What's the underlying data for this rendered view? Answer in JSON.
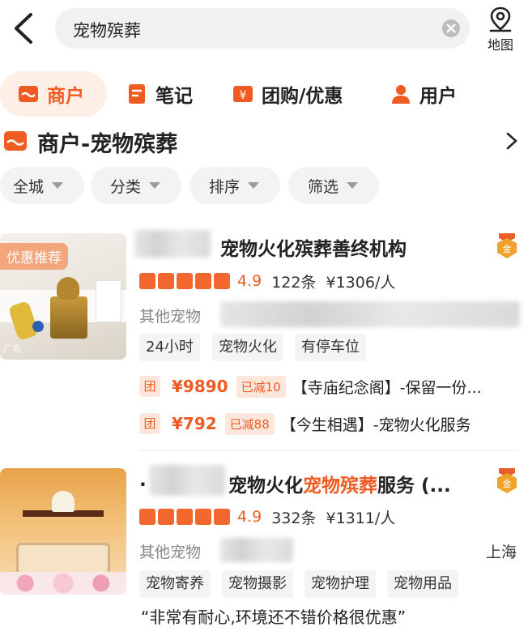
{
  "search": {
    "query": "宠物殡葬"
  },
  "header": {
    "map_label": "地图"
  },
  "tabs": [
    {
      "label": "商户"
    },
    {
      "label": "笔记"
    },
    {
      "label": "团购/优惠"
    },
    {
      "label": "用户"
    }
  ],
  "section": {
    "title": "商户-宠物殡葬"
  },
  "filters": [
    {
      "label": "全城"
    },
    {
      "label": "分类"
    },
    {
      "label": "排序"
    },
    {
      "label": "筛选"
    }
  ],
  "shops": [
    {
      "name": "宠物火化殡葬善终机构",
      "promo_tag": "优惠推荐",
      "ad_tag": "广告",
      "stars": 5,
      "score": "4.9",
      "reviews": "122条",
      "price": "¥1306/人",
      "category": "其他宠物",
      "tags": [
        "24小时",
        "宠物火化",
        "有停车位"
      ],
      "deals": [
        {
          "badge": "团",
          "price": "¥9890",
          "off": "已减10",
          "desc": "【寺庙纪念阁】-保留一份..."
        },
        {
          "badge": "团",
          "price": "¥792",
          "off": "已减88",
          "desc": "【今生相遇】-宠物火化服务"
        }
      ]
    },
    {
      "name_prefix": ".",
      "name_pre": "宠物火化",
      "name_highlight": "宠物殡葬",
      "name_post": "服务 (...",
      "stars": 5,
      "score": "4.9",
      "reviews": "332条",
      "price": "¥1311/人",
      "category": "其他宠物",
      "city": "上海",
      "tags": [
        "宠物寄养",
        "宠物摄影",
        "宠物护理",
        "宠物用品"
      ],
      "review": "“非常有耐心,环境还不错价格很优惠”"
    }
  ],
  "colors": {
    "accent": "#ef5b21",
    "accent_soft": "#fdeee6",
    "medal": "#f0a32c"
  }
}
